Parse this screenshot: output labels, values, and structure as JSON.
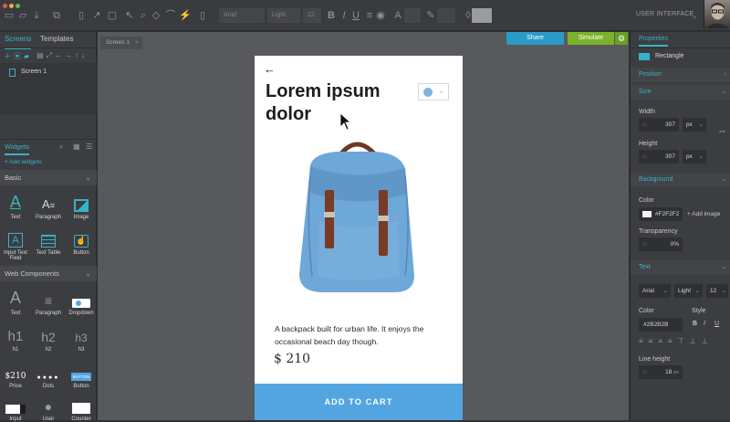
{
  "toolbar": {
    "font_family": "Arial",
    "font_weight": "Light",
    "font_size": "12",
    "ui_mode": "USER INTERFACE"
  },
  "left_panel": {
    "tabs": [
      "Screens",
      "Templates"
    ],
    "screens": [
      {
        "label": "Screen 1"
      }
    ],
    "widgets_tab": "Widgets",
    "add_widgets": "+ Add widgets",
    "basic_section": "Basic",
    "basic_widgets": [
      "Text",
      "Paragraph",
      "Image",
      "Input Text Field",
      "Text Table",
      "Button"
    ],
    "web_section": "Web Components",
    "web_widgets": [
      "Text",
      "Paragraph",
      "Dropdown",
      "h1",
      "h2",
      "h3",
      "Price",
      "Dots",
      "Button",
      "Input",
      "User",
      "Counter"
    ],
    "heading_glyphs": [
      "h1",
      "h2",
      "h3"
    ],
    "price_glyph": "$210",
    "button_glyph": "BUTTON"
  },
  "canvas": {
    "tab_label": "Screen 1",
    "share_label": "Share",
    "simulate_label": "Simulate"
  },
  "product": {
    "title": "Lorem ipsum dolor",
    "description": "A backpack built for urban life. It enjoys the occasional beach day though.",
    "price": "$ 210",
    "cta_label": "ADD TO CART"
  },
  "properties": {
    "tab": "Properties",
    "element": "Rectangle",
    "position_label": "Position",
    "size_label": "Size",
    "width_label": "Width",
    "width_value": "307",
    "height_label": "Height",
    "height_value": "307",
    "unit": "px",
    "background_label": "Background",
    "color_label": "Color",
    "color_value": "#F2F2F2",
    "add_image": "+ Add image",
    "transparency_label": "Transparency",
    "transparency_value": "0%",
    "text_label": "Text",
    "font_family": "Arial",
    "font_weight": "Light",
    "font_size": "12",
    "text_color_label": "Color",
    "text_color_value": "#2B2B2B",
    "style_label": "Style",
    "style_buttons": [
      "B",
      "I",
      "U"
    ],
    "line_height_label": "Line height",
    "line_height_value": "18",
    "line_height_unit": "px"
  },
  "colors": {
    "accent": "#38b2c6",
    "share_btn": "#2a9ac6",
    "simulate_btn": "#7bb22a",
    "cta": "#52a5e0",
    "backpack": "#6ea8d8",
    "strap": "#7a3b25"
  }
}
